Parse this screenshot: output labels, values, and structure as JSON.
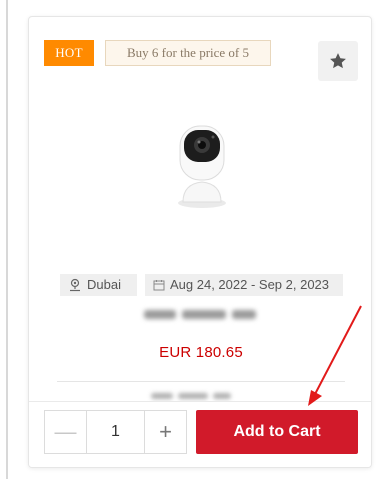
{
  "badges": {
    "hot": "HOT",
    "promo": "Buy 6 for the price of 5"
  },
  "favorite": {
    "icon": "star-icon"
  },
  "product": {
    "image": "webcam-icon",
    "location": "Dubai",
    "dates": "Aug 24, 2022 - Sep 2, 2023",
    "price": "EUR 180.65"
  },
  "cart": {
    "quantity": "1",
    "minus": "—",
    "plus": "+",
    "add_label": "Add to Cart"
  },
  "colors": {
    "hot": "#ff8a00",
    "price": "#cc0000",
    "cart_button": "#d11a2a",
    "annotation_arrow": "#e21a1a"
  }
}
